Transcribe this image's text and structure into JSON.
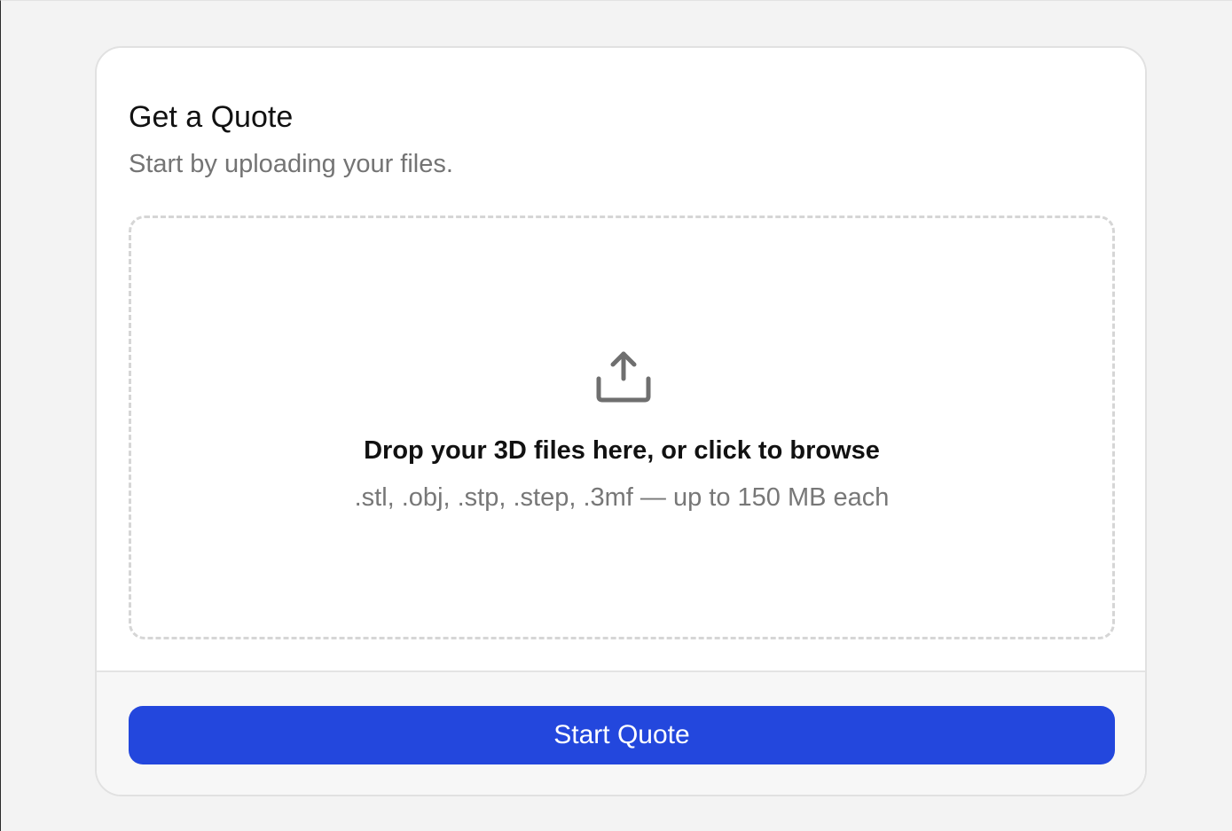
{
  "quote_card": {
    "title": "Get a Quote",
    "subtitle": "Start by uploading your files.",
    "dropzone": {
      "icon": "upload-icon",
      "title": "Drop your 3D files here, or click to browse",
      "hint": ".stl, .obj, .stp, .step, .3mf — up to 150 MB each"
    },
    "start_button_label": "Start Quote"
  },
  "colors": {
    "page_background": "#f3f3f3",
    "card_background": "#ffffff",
    "footer_background": "#f7f7f7",
    "accent": "#2347dd",
    "title_text": "#111111",
    "muted_text": "#777777",
    "dashed_border": "#d6d6d6"
  }
}
